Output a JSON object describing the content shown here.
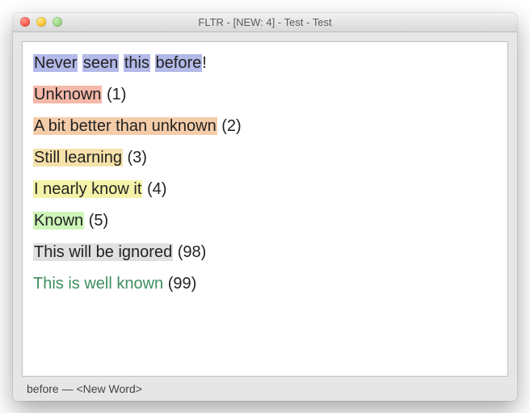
{
  "window": {
    "title": "FLTR - [NEW: 4] - Test - Test"
  },
  "colors": {
    "new": "#B3B9E8",
    "level1": "#F5B8A9",
    "level2": "#F5CCA9",
    "level3": "#F5E1A9",
    "level4": "#F5F3A9",
    "level5": "#CDF5B8",
    "ignored": "#E0E0E0",
    "wellknown_fg": "#3E8E60"
  },
  "lines": [
    {
      "segments": [
        {
          "text": "Never",
          "hl": "new"
        },
        {
          "text": " "
        },
        {
          "text": "seen",
          "hl": "new"
        },
        {
          "text": " "
        },
        {
          "text": "this",
          "hl": "new"
        },
        {
          "text": " "
        },
        {
          "text": "before",
          "hl": "new"
        },
        {
          "text": "!"
        }
      ]
    },
    {
      "segments": [
        {
          "text": "Unknown",
          "hl": "level1"
        },
        {
          "text": " (1)"
        }
      ]
    },
    {
      "segments": [
        {
          "text": "A bit better than unknown",
          "hl": "level2"
        },
        {
          "text": " (2)"
        }
      ]
    },
    {
      "segments": [
        {
          "text": "Still learning",
          "hl": "level3"
        },
        {
          "text": " (3)"
        }
      ]
    },
    {
      "segments": [
        {
          "text": "I nearly know it",
          "hl": "level4"
        },
        {
          "text": " (4)"
        }
      ]
    },
    {
      "segments": [
        {
          "text": "Known",
          "hl": "level5"
        },
        {
          "text": " (5)"
        }
      ]
    },
    {
      "segments": [
        {
          "text": "This will be ignored",
          "hl": "ignored"
        },
        {
          "text": " (98)"
        }
      ]
    },
    {
      "segments": [
        {
          "text": "This is well known",
          "fg": "wellknown_fg"
        },
        {
          "text": " (99)"
        }
      ]
    }
  ],
  "status": {
    "text": "before — <New Word>"
  }
}
